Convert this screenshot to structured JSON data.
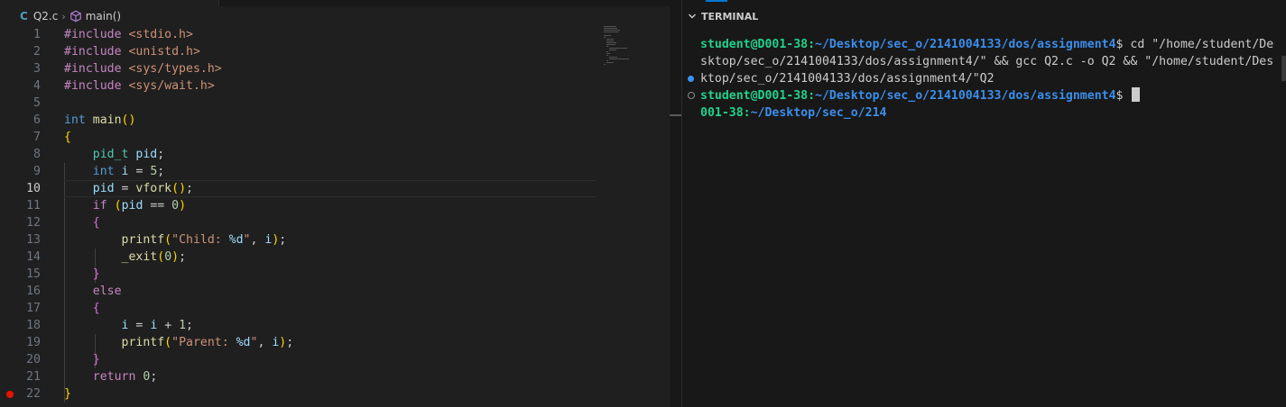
{
  "editor": {
    "breadcrumb": {
      "lang_icon": "C",
      "file": "Q2.c",
      "symbol": "main()",
      "symbol_icon": "cube-icon"
    },
    "active_line": "10",
    "breakpoint_line": "22",
    "lines": [
      {
        "n": "1",
        "t": "#include <stdio.h>"
      },
      {
        "n": "2",
        "t": "#include <unistd.h>"
      },
      {
        "n": "3",
        "t": "#include <sys/types.h>"
      },
      {
        "n": "4",
        "t": "#include <sys/wait.h>"
      },
      {
        "n": "5",
        "t": ""
      },
      {
        "n": "6",
        "t": "int main()"
      },
      {
        "n": "7",
        "t": "{"
      },
      {
        "n": "8",
        "t": "    pid_t pid;"
      },
      {
        "n": "9",
        "t": "    int i = 5;"
      },
      {
        "n": "10",
        "t": "    pid = vfork();"
      },
      {
        "n": "11",
        "t": "    if (pid == 0)"
      },
      {
        "n": "12",
        "t": "    {"
      },
      {
        "n": "13",
        "t": "        printf(\"Child: %d\", i);"
      },
      {
        "n": "14",
        "t": "        _exit(0);"
      },
      {
        "n": "15",
        "t": "    }"
      },
      {
        "n": "16",
        "t": "    else"
      },
      {
        "n": "17",
        "t": "    {"
      },
      {
        "n": "18",
        "t": "        i = i + 1;"
      },
      {
        "n": "19",
        "t": "        printf(\"Parent: %d\", i);"
      },
      {
        "n": "20",
        "t": "    }"
      },
      {
        "n": "21",
        "t": "    return 0;"
      },
      {
        "n": "22",
        "t": "}"
      }
    ]
  },
  "terminal": {
    "title": "TERMINAL",
    "lines": [
      {
        "user": "student@D001-38",
        "colon": ":",
        "path": "~/Desktop/sec_o/2141004133/dos/assignment4",
        "rest": "$ cd \"/home/student/De"
      },
      {
        "rest": "sktop/sec_o/2141004133/dos/assignment4/\" && gcc Q2.c -o Q2 && \"/home/student/Des"
      },
      {
        "rest": "ktop/sec_o/2141004133/dos/assignment4/\"Q2"
      },
      {
        "user": "student@D001-38",
        "colon": ":",
        "path": "~/Desktop/sec_o/2141004133/dos/assignment4",
        "rest": "$ "
      },
      {
        "user": "001-38",
        "colon": ":",
        "path": "~/Desktop/sec_o/214",
        "rest": ""
      }
    ]
  },
  "colors": {
    "editor_bg": "#1f1f1f",
    "terminal_bg": "#181818",
    "prompt_user": "#23d18b",
    "prompt_path": "#3b8eea",
    "breakpoint": "#e51400"
  }
}
